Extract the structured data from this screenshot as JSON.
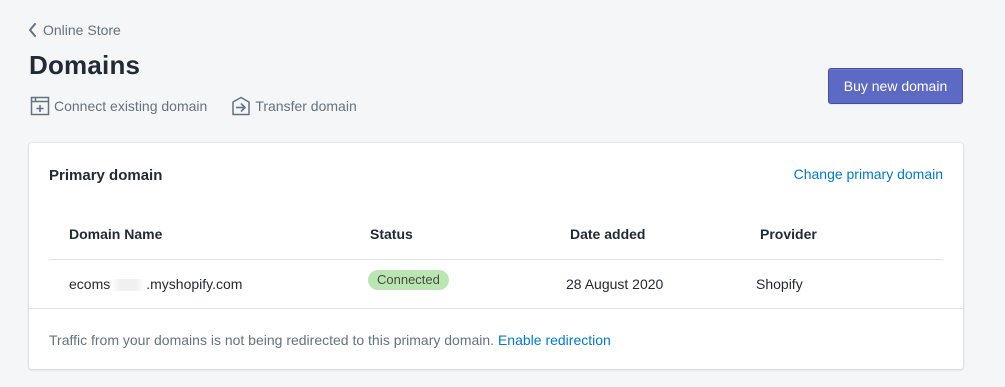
{
  "breadcrumb": {
    "label": "Online Store"
  },
  "page": {
    "title": "Domains"
  },
  "actions": {
    "connect_label": "Connect existing domain",
    "transfer_label": "Transfer domain",
    "buy_label": "Buy new domain"
  },
  "card": {
    "title": "Primary domain",
    "change_link": "Change primary domain",
    "columns": [
      "Domain Name",
      "Status",
      "Date added",
      "Provider"
    ],
    "rows": [
      {
        "domain_prefix": "ecoms",
        "domain_suffix": ".myshopify.com",
        "status": "Connected",
        "date_added": "28 August 2020",
        "provider": "Shopify"
      }
    ],
    "footer_text": "Traffic from your domains is not being redirected to this primary domain.",
    "footer_link": "Enable redirection"
  },
  "colors": {
    "primary": "#5c6ac4",
    "link": "#007ace",
    "success_badge": "#bbe5b3",
    "background": "#f4f6f8"
  },
  "icons": {
    "back": "chevron-left-icon",
    "connect": "connect-domain-icon",
    "transfer": "transfer-domain-icon"
  }
}
